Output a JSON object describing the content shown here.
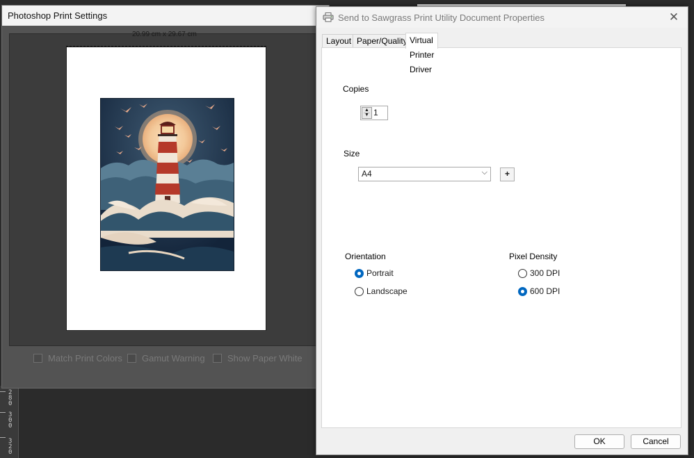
{
  "photoshop_window": {
    "title": "Photoshop Print Settings",
    "paper_dimensions": "20.99 cm x 29.67 cm",
    "options": [
      {
        "label": "Match Print Colors",
        "checked": false
      },
      {
        "label": "Gamut Warning",
        "checked": false
      },
      {
        "label": "Show Paper White",
        "checked": false
      }
    ]
  },
  "ruler": {
    "numbers": [
      "280",
      "300",
      "320"
    ]
  },
  "dialog": {
    "title": "Send to Sawgrass Print Utility Document Properties",
    "title_icon": "printer-icon",
    "close_glyph": "✕",
    "tabs": [
      {
        "label": "Layout",
        "active": false
      },
      {
        "label": "Paper/Quality",
        "active": false
      },
      {
        "label": "Virtual Printer Driver",
        "active": true
      }
    ],
    "copies": {
      "label": "Copies",
      "value": "1"
    },
    "size": {
      "label": "Size",
      "selected": "A4",
      "add_label": "+"
    },
    "orientation": {
      "label": "Orientation",
      "options": [
        {
          "label": "Portrait",
          "selected": true
        },
        {
          "label": "Landscape",
          "selected": false
        }
      ]
    },
    "pixel_density": {
      "label": "Pixel Density",
      "options": [
        {
          "label": "300 DPI",
          "selected": false
        },
        {
          "label": "600 DPI",
          "selected": true
        }
      ]
    },
    "buttons": {
      "ok": "OK",
      "cancel": "Cancel"
    }
  },
  "colors": {
    "accent": "#0067c0",
    "dark_bg": "#2b2b2b",
    "panel_bg": "#535353"
  }
}
